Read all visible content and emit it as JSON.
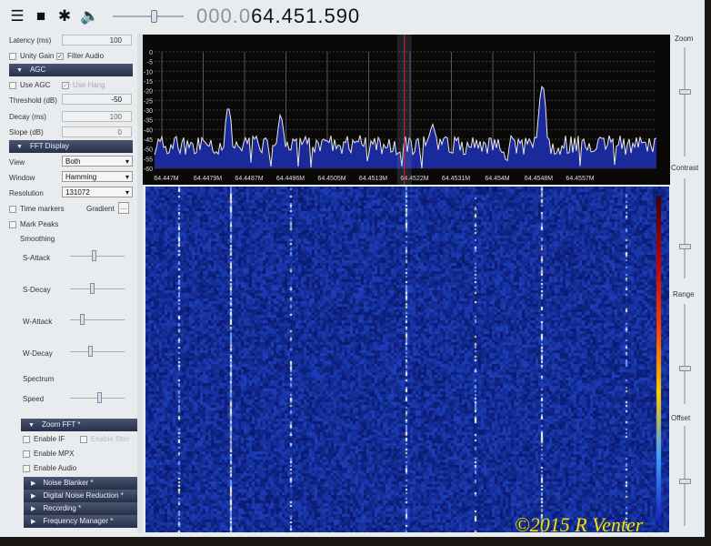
{
  "toolbar": {
    "menu_icon": "hamburger-icon",
    "stop_icon": "stop-icon",
    "settings_icon": "gear-icon",
    "audio_icon": "speaker-icon",
    "volume_level": 0.55,
    "frequency_dim": "000.0",
    "frequency_main": "64.451.590"
  },
  "audio": {
    "latency_label": "Latency (ms)",
    "latency_value": "100",
    "unity_gain_label": "Unity Gain",
    "unity_gain_checked": false,
    "filter_audio_label": "Filter Audio",
    "filter_audio_checked": true
  },
  "agc": {
    "title": "AGC",
    "use_agc_label": "Use AGC",
    "use_hang_label": "Use Hang",
    "threshold_label": "Threshold (dB)",
    "threshold_value": "-50",
    "decay_label": "Decay (ms)",
    "decay_value": "100",
    "slope_label": "Slope (dB)",
    "slope_value": "0"
  },
  "fft": {
    "title": "FFT Display",
    "view_label": "View",
    "view_value": "Both",
    "window_label": "Window",
    "window_value": "Hamming",
    "resolution_label": "Resolution",
    "resolution_value": "131072",
    "time_markers_label": "Time markers",
    "gradient_label": "Gradient",
    "gradient_button": "...",
    "mark_peaks_label": "Mark Peaks",
    "smoothing_label": "Smoothing",
    "s_attack_label": "S-Attack",
    "s_decay_label": "S-Decay",
    "w_attack_label": "W-Attack",
    "w_decay_label": "W-Decay",
    "spectrum_label": "Spectrum",
    "speed_label": "Speed"
  },
  "zoom_fft": {
    "title": "Zoom FFT *",
    "enable_if_label": "Enable IF",
    "enable_filter_label": "Enable filter",
    "enable_mpx_label": "Enable MPX",
    "enable_audio_label": "Enable Audio"
  },
  "collapsed_panels": [
    "Noise Blanker *",
    "Digital Noise Reduction *",
    "Recording *",
    "Frequency Manager *"
  ],
  "right_panel": {
    "zoom_label": "Zoom",
    "contrast_label": "Contrast",
    "range_label": "Range",
    "offset_label": "Offset"
  },
  "chart_data": {
    "type": "line",
    "ylim": [
      -60,
      0
    ],
    "yticks": [
      "0",
      "-5",
      "-10",
      "-15",
      "-20",
      "-25",
      "-30",
      "-35",
      "-40",
      "-45",
      "-50",
      "-55",
      "-60"
    ],
    "xticks": [
      "64.447M",
      "64.4479M",
      "64.4487M",
      "64.4496M",
      "64.4505M",
      "64.4513M",
      "64.4522M",
      "64.4531M",
      "64.454M",
      "64.4548M",
      "64.4557M"
    ],
    "noise_floor_db": -48,
    "peaks": [
      {
        "freq_mhz": 64.4484,
        "db": -28
      },
      {
        "freq_mhz": 64.4495,
        "db": -32
      },
      {
        "freq_mhz": 64.4527,
        "db": -36
      },
      {
        "freq_mhz": 64.455,
        "db": -17
      }
    ],
    "center_marker_mhz": 64.4521,
    "line_color": "#e8e8e8",
    "fill_color": "#1a2a9a",
    "marker_color": "#e02020"
  },
  "watermark": "©2015 R Venter"
}
